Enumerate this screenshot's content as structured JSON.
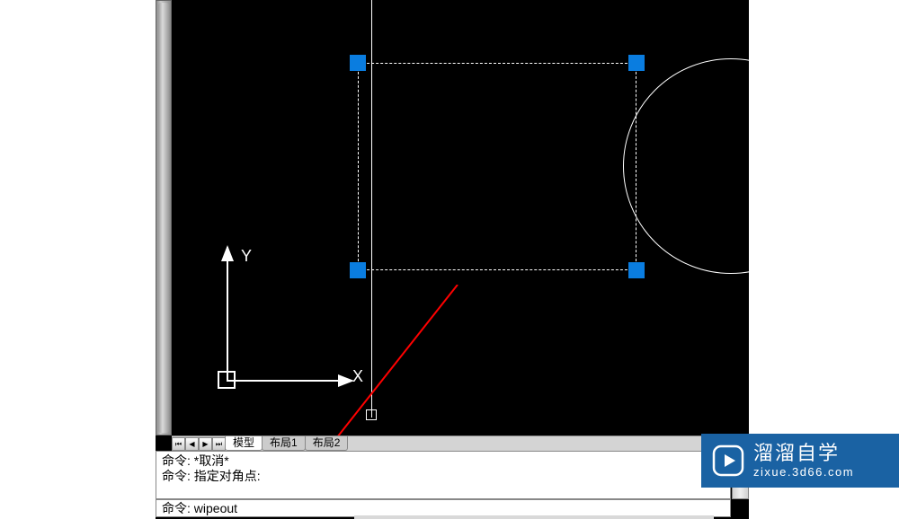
{
  "tabs": {
    "model": "模型",
    "layout1": "布局1",
    "layout2": "布局2"
  },
  "ucs": {
    "x_label": "X",
    "y_label": "Y"
  },
  "command_history": {
    "line1": "命令: *取消*",
    "line2": "命令: 指定对角点:"
  },
  "command_line": {
    "prompt": "命令: ",
    "value": "wipeout"
  },
  "watermark": {
    "title": "溜溜自学",
    "url": "zixue.3d66.com"
  },
  "colors": {
    "grip": "#0a7de0",
    "watermark_bg": "#1a62a3"
  }
}
